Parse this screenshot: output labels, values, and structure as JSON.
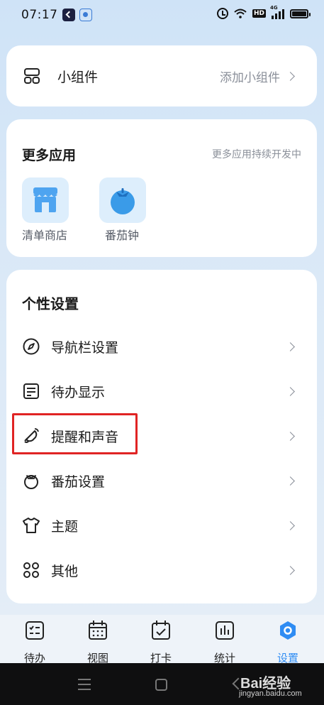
{
  "status_bar": {
    "time": "07:17",
    "icons": [
      "app-k-icon",
      "baidu-paw-icon",
      "alarm-icon",
      "wifi-icon",
      "hd-icon",
      "signal-4g-icon",
      "battery-icon"
    ],
    "hd_label": "HD",
    "network_label": "4G"
  },
  "widget_card": {
    "label": "小组件",
    "action": "添加小组件",
    "icon": "widget-grid-icon"
  },
  "more_apps": {
    "title": "更多应用",
    "subtitle": "更多应用持续开发中",
    "apps": [
      {
        "label": "清单商店",
        "icon": "store-icon"
      },
      {
        "label": "番茄钟",
        "icon": "tomato-icon"
      }
    ]
  },
  "personal_settings": {
    "title": "个性设置",
    "items": [
      {
        "label": "导航栏设置",
        "icon": "compass-icon"
      },
      {
        "label": "待办显示",
        "icon": "todo-display-icon"
      },
      {
        "label": "提醒和声音",
        "icon": "bell-icon",
        "highlighted": true
      },
      {
        "label": "番茄设置",
        "icon": "tomato-outline-icon"
      },
      {
        "label": "主题",
        "icon": "tshirt-icon"
      },
      {
        "label": "其他",
        "icon": "four-dots-icon"
      }
    ]
  },
  "tab_bar": {
    "tabs": [
      {
        "label": "待办",
        "icon": "todo-list-icon",
        "active": false
      },
      {
        "label": "视图",
        "icon": "calendar-icon",
        "active": false
      },
      {
        "label": "打卡",
        "icon": "checkin-icon",
        "active": false
      },
      {
        "label": "统计",
        "icon": "stats-icon",
        "active": false
      },
      {
        "label": "设置",
        "icon": "settings-hex-icon",
        "active": true
      }
    ],
    "active_color": "#2f8cf3"
  },
  "watermark": {
    "brand": "Bai经验",
    "url": "jingyan.baidu.com"
  },
  "colors": {
    "accent": "#2f8cf3",
    "highlight_border": "#e02424",
    "app_tile_bg": "#ddeefc"
  }
}
